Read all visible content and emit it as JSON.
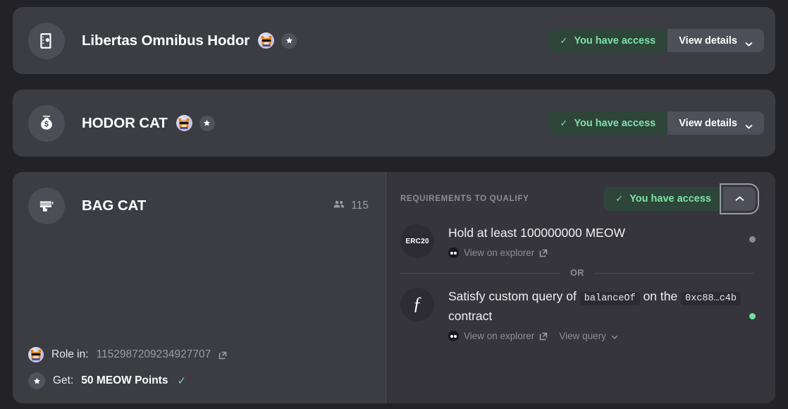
{
  "colors": {
    "page_bg": "#232327",
    "card_bg": "#3c3c43",
    "panel_bg": "#35353b",
    "access_green_bg": "#2e4539",
    "access_green_text": "#7ee2a8",
    "status_pending": "#8d8d97",
    "status_satisfied": "#6fe0a0"
  },
  "cards": [
    {
      "icon": "notebook-icon",
      "title": "Libertas Omnibus Hodor",
      "avatar": "cat-avatar",
      "badge": "star-icon",
      "access_label": "You have access",
      "access_check": "✓",
      "details_label": "View details",
      "details_chevron": "chevron-down-icon"
    },
    {
      "icon": "money-bag-icon",
      "title": "HODOR CAT",
      "avatar": "cat-avatar",
      "badge": "star-icon",
      "access_label": "You have access",
      "access_check": "✓",
      "details_label": "View details",
      "details_chevron": "chevron-down-icon"
    }
  ],
  "expanded_card": {
    "icon": "money-gun-icon",
    "title": "BAG CAT",
    "members": {
      "icon": "users-icon",
      "count": "115"
    },
    "meta": [
      {
        "icon": "cat-avatar",
        "label": "Role in:",
        "value": "1152987209234927707",
        "value_style": "muted",
        "link_icon": "external-link-icon",
        "check": ""
      },
      {
        "icon": "star-icon",
        "label": "Get:",
        "value": "50 MEOW Points",
        "value_style": "strong",
        "link_icon": "",
        "check": "✓"
      }
    ],
    "requirements_panel": {
      "heading": "REQUIREMENTS TO QUALIFY",
      "access_label": "You have access",
      "access_check": "✓",
      "collapse_icon": "chevron-up-icon",
      "or_label": "OR",
      "requirements": [
        {
          "badge_type": "erc20",
          "badge_label": "ERC20",
          "text_parts": [
            {
              "type": "text",
              "value": "Hold at least 100000000 MEOW"
            }
          ],
          "links": [
            {
              "icon": "explorer-icon",
              "label": "View on explorer",
              "trailing_icon": "external-link-icon"
            }
          ],
          "status": "pending",
          "status_color": "#8d8d97"
        },
        {
          "badge_type": "function",
          "badge_label": "ƒ",
          "text_parts": [
            {
              "type": "text",
              "value": "Satisfy custom query of"
            },
            {
              "type": "code",
              "value": "balanceOf"
            },
            {
              "type": "text",
              "value": "on the"
            },
            {
              "type": "code",
              "value": "0xc88…c4b"
            },
            {
              "type": "text",
              "value": "contract"
            }
          ],
          "links": [
            {
              "icon": "explorer-icon",
              "label": "View on explorer",
              "trailing_icon": "external-link-icon"
            },
            {
              "icon": "",
              "label": "View query",
              "trailing_icon": "chevron-down-icon"
            }
          ],
          "status": "satisfied",
          "status_color": "#6fe0a0"
        }
      ]
    }
  }
}
